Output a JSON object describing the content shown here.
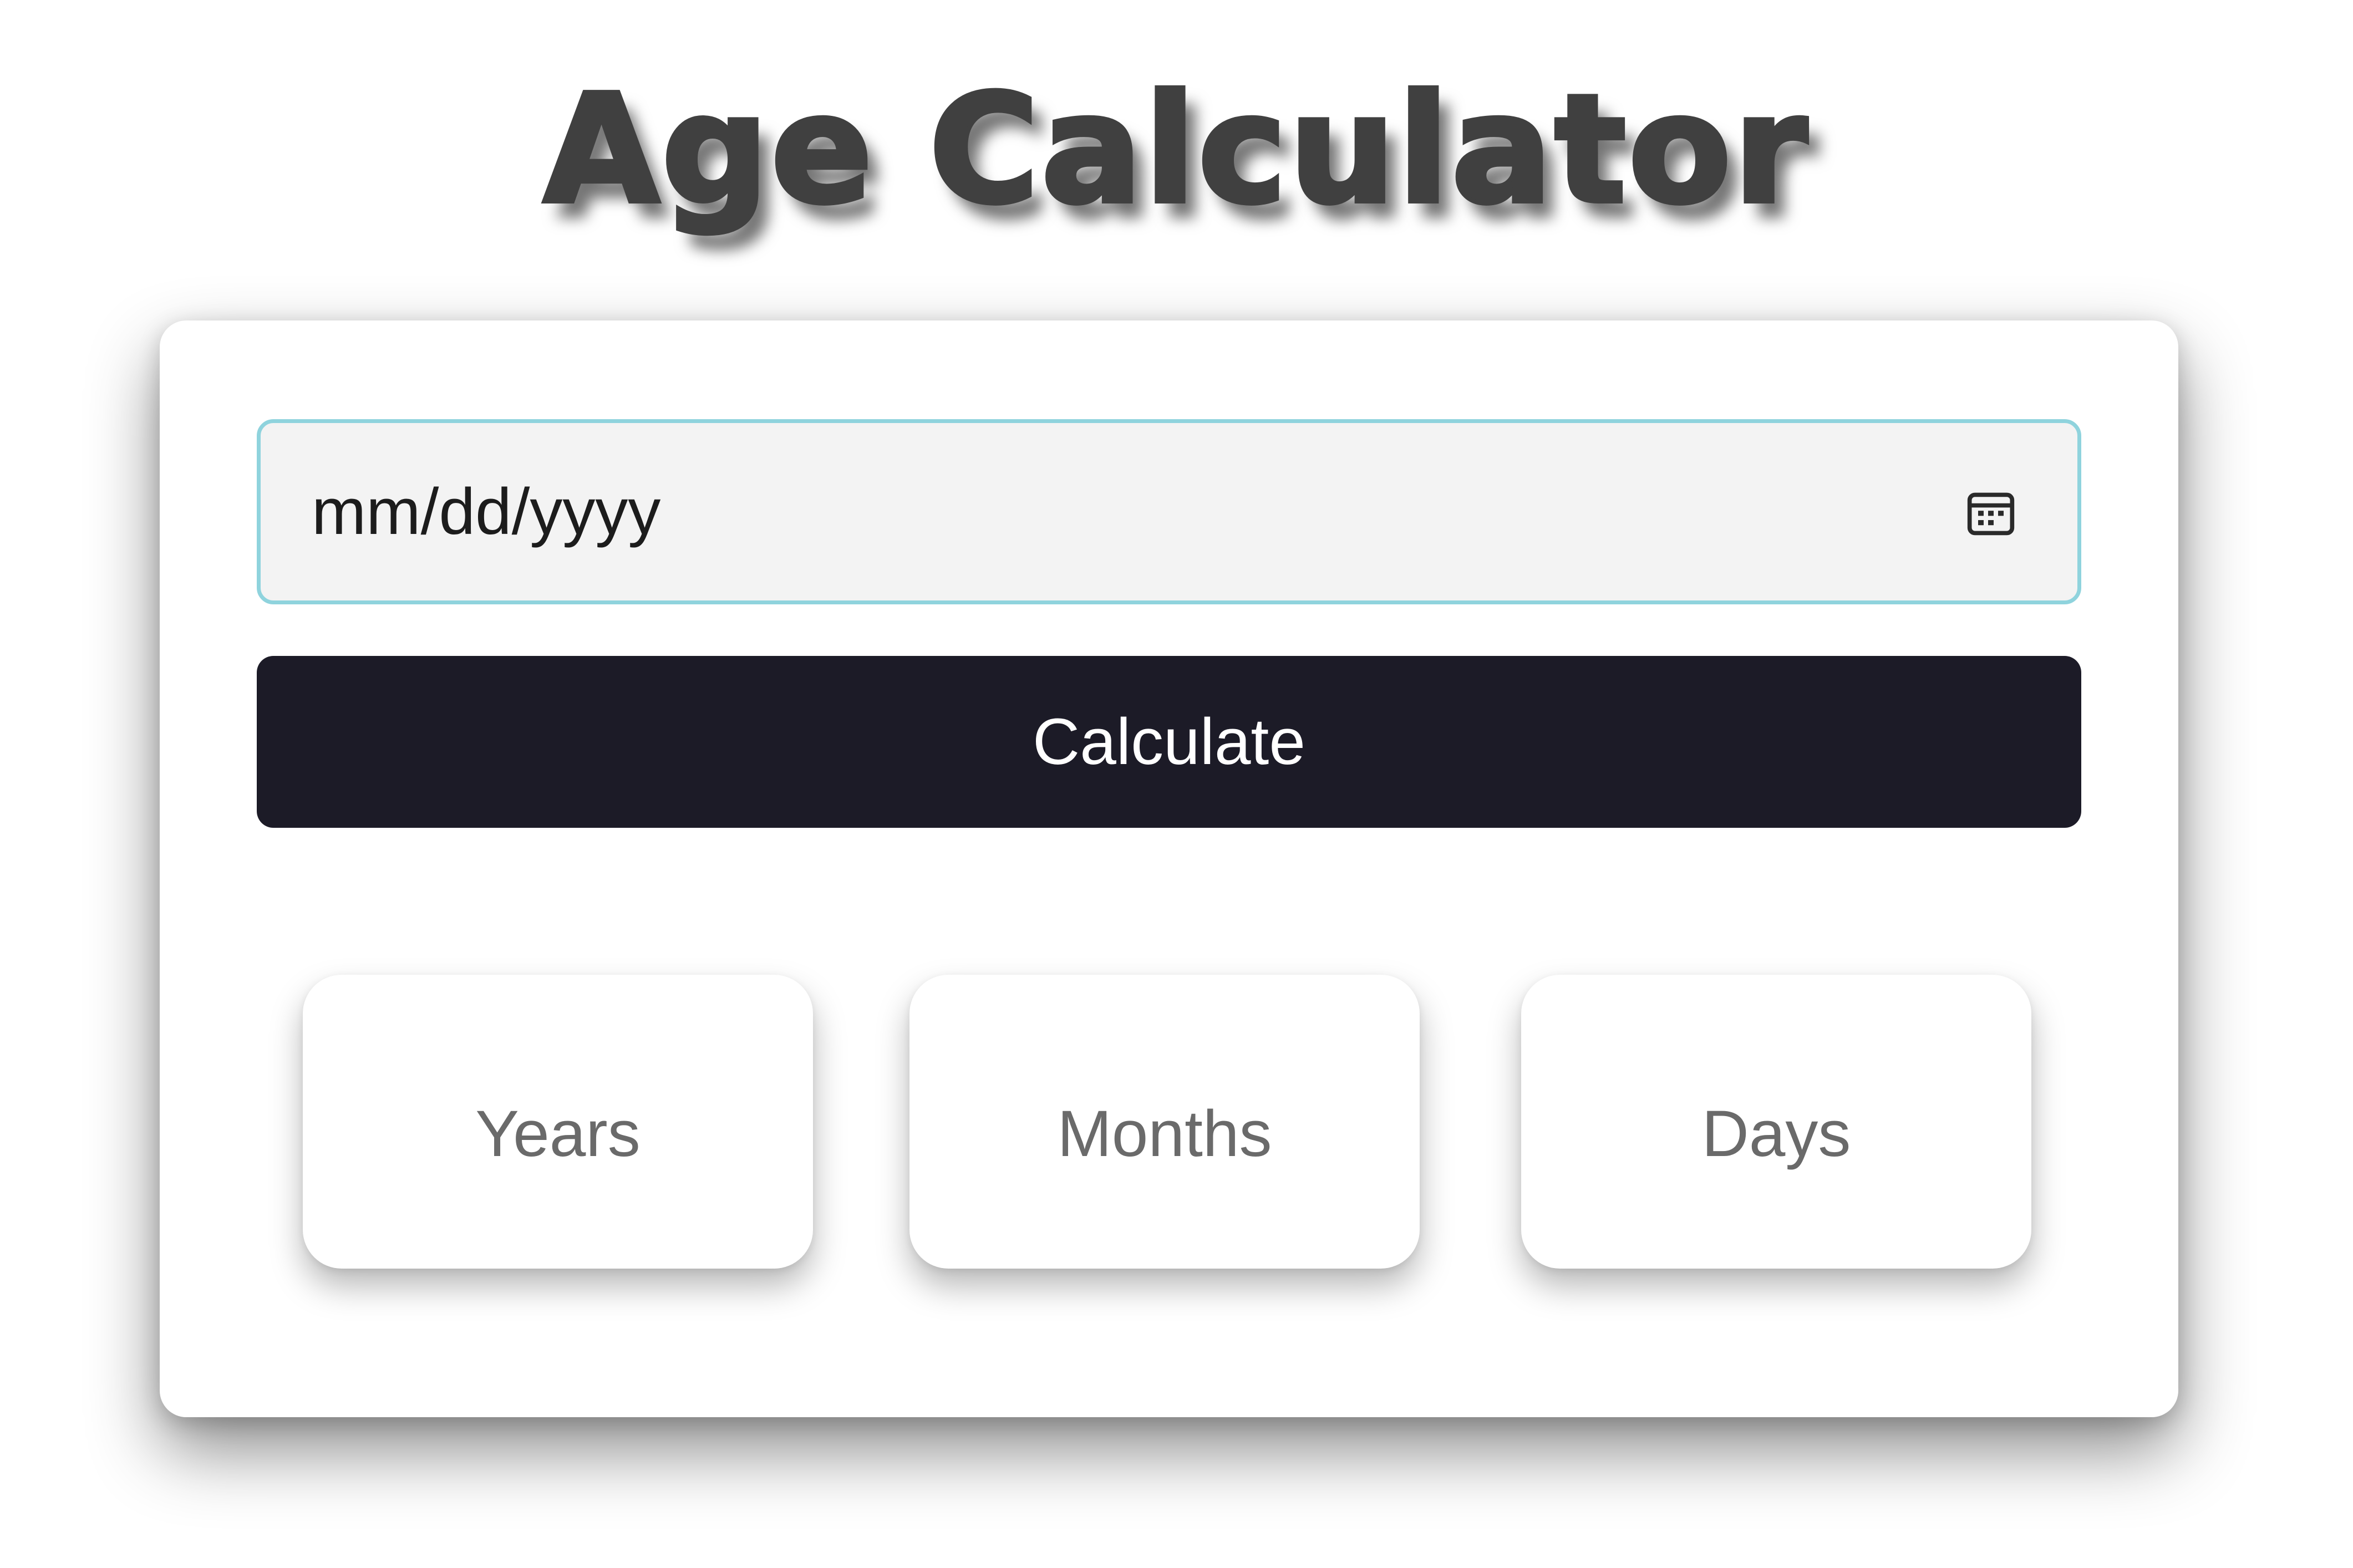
{
  "header": {
    "title": "Age Calculator"
  },
  "form": {
    "date_placeholder": "mm/dd/yyyy",
    "calendar_icon": "calendar-icon",
    "calculate_label": "Calculate"
  },
  "results": [
    {
      "label": "Years"
    },
    {
      "label": "Months"
    },
    {
      "label": "Days"
    }
  ],
  "colors": {
    "title": "#404040",
    "button_bg": "#1c1b27",
    "input_border": "#8fd3dd",
    "input_bg": "#f3f3f3",
    "result_text": "#6a6a6a"
  }
}
